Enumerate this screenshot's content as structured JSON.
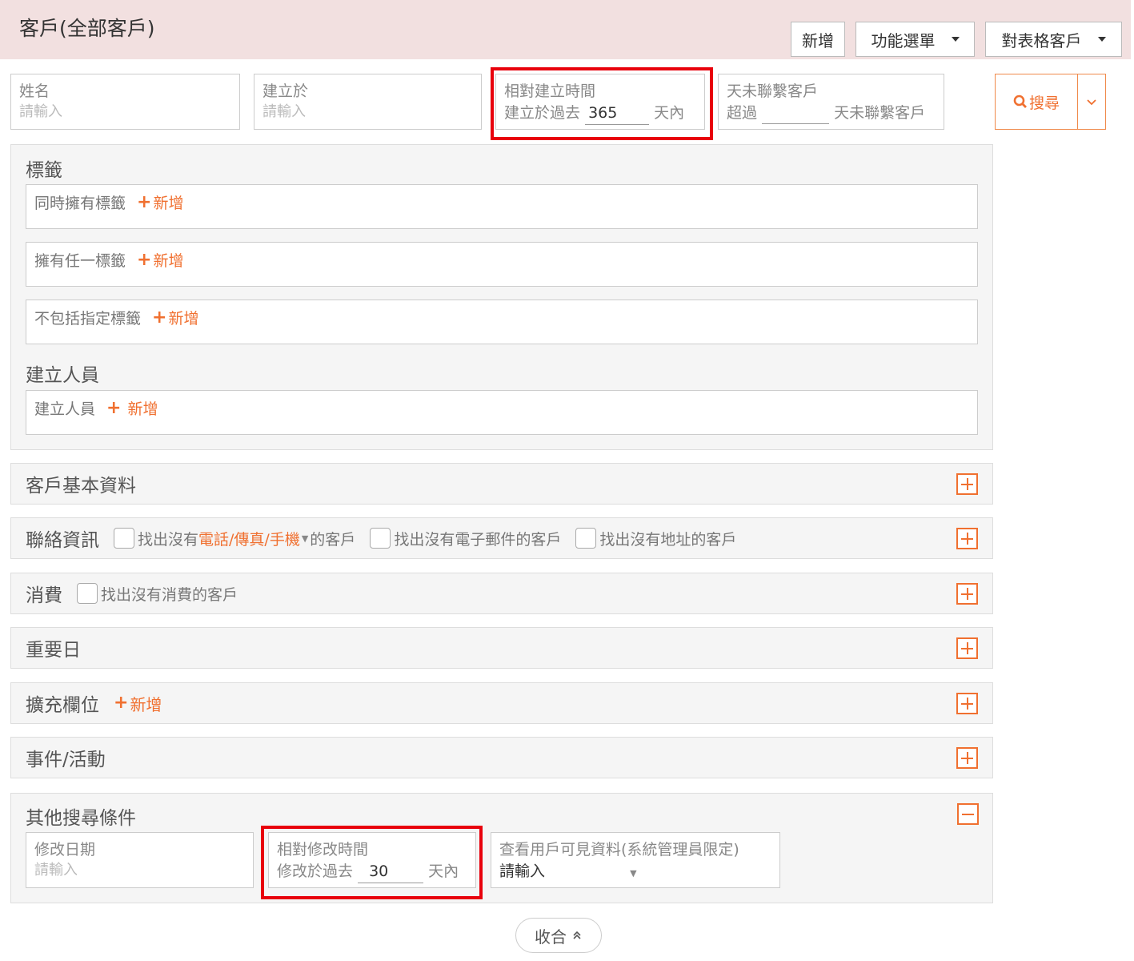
{
  "header": {
    "title": "客戶(全部客戶)",
    "add_label": "新增",
    "menu_label": "功能選單",
    "export_label": "對表格客戶"
  },
  "filters": {
    "name": {
      "label": "姓名",
      "placeholder": "請輸入"
    },
    "created": {
      "label": "建立於",
      "placeholder": "請輸入"
    },
    "relative_created": {
      "label": "相對建立時間",
      "prefix": "建立於過去",
      "value": "365",
      "suffix": "天內"
    },
    "no_contact": {
      "label": "天未聯繫客戶",
      "prefix": "超過",
      "value": "",
      "suffix": "天未聯繫客戶"
    },
    "search_label": "搜尋"
  },
  "tags": {
    "title": "標籤",
    "all_label": "同時擁有標籤",
    "any_label": "擁有任一標籤",
    "exclude_label": "不包括指定標籤",
    "add_label": "新增"
  },
  "creator": {
    "title": "建立人員",
    "label": "建立人員",
    "add_label": "新增"
  },
  "sections": {
    "basic": "客戶基本資料",
    "contact": {
      "title": "聯絡資訊",
      "no_phone_pre": "找出沒有",
      "no_phone_hl": "電話/傳真/手機",
      "no_phone_post": "的客戶",
      "no_email": "找出沒有電子郵件的客戶",
      "no_address": "找出沒有地址的客戶"
    },
    "consumption": {
      "title": "消費",
      "no_consumption": "找出沒有消費的客戶"
    },
    "important_date": "重要日",
    "extended": {
      "title": "擴充欄位",
      "add_label": "新增"
    },
    "events": "事件/活動",
    "other": {
      "title": "其他搜尋條件",
      "modified": {
        "label": "修改日期",
        "placeholder": "請輸入"
      },
      "relative_modified": {
        "label": "相對修改時間",
        "prefix": "修改於過去",
        "value": "30",
        "suffix": "天內"
      },
      "visibility": {
        "label": "查看用戶可見資料(系統管理員限定)",
        "value": "請輸入"
      }
    }
  },
  "collapse_label": "收合",
  "accent_color": "#f07030",
  "highlight_color": "#e8000c"
}
